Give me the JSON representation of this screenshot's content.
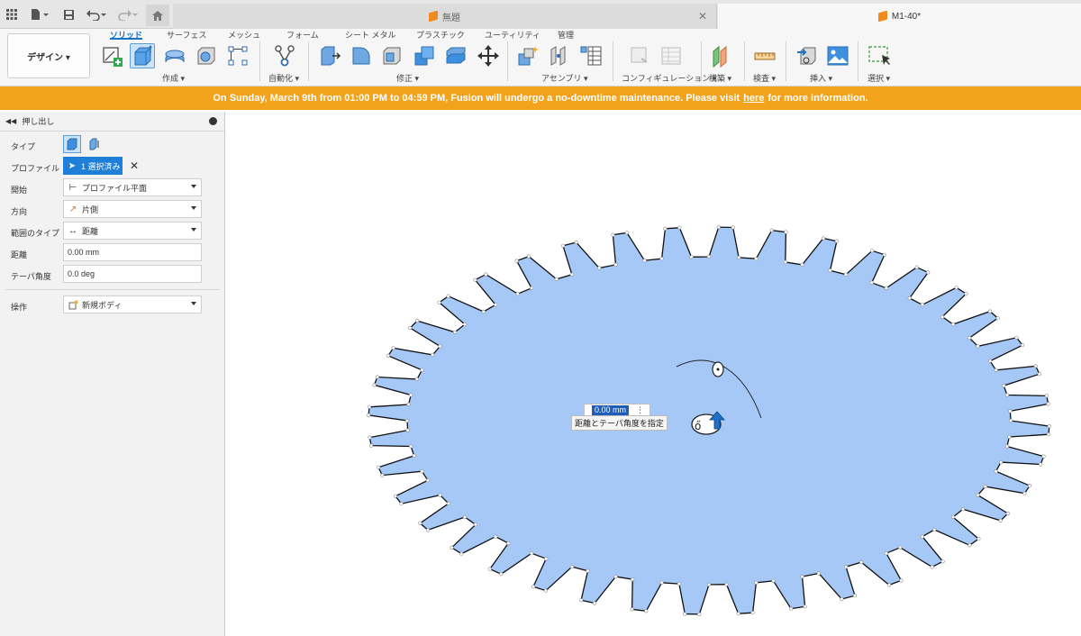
{
  "app": {
    "doc_tabs": [
      {
        "label": "無題"
      },
      {
        "label": "M1-40*"
      }
    ]
  },
  "toolbar": {
    "workspace": "デザイン ▾",
    "tabs": [
      "ソリッド",
      "サーフェス",
      "メッシュ",
      "フォーム",
      "シート メタル",
      "プラスチック",
      "ユーティリティ",
      "管理"
    ],
    "groups": {
      "create": "作成 ▾",
      "automate": "自動化 ▾",
      "modify": "修正 ▾",
      "assemble": "アセンブリ ▾",
      "configure": "コンフィギュレーション ▾",
      "construct": "構築 ▾",
      "inspect": "検査 ▾",
      "insert": "挿入 ▾",
      "select": "選択 ▾"
    }
  },
  "banner": {
    "before": "On Sunday, March 9th from 01:00 PM to 04:59 PM, Fusion will undergo a no-downtime maintenance. Please visit",
    "link": "here",
    "after": "for more information.",
    "color": "#f3a21c"
  },
  "panel": {
    "title": "押し出し",
    "rows": {
      "type_label": "タイプ",
      "profile_label": "プロファイル",
      "profile_value": "1 選択済み",
      "start_label": "開始",
      "start_value": "プロファイル平面",
      "direction_label": "方向",
      "direction_value": "片側",
      "extent_label": "範囲のタイプ",
      "extent_value": "距離",
      "distance_label": "距離",
      "distance_value": "0.00 mm",
      "taper_label": "テーパ角度",
      "taper_value": "0.0 deg",
      "operation_label": "操作",
      "operation_value": "新規ボディ"
    }
  },
  "canvas": {
    "distance_input": "0.00 mm",
    "tooltip": "距離とテーパ角度を指定",
    "gear_color": "#a6c8f7",
    "gear_teeth": 40
  }
}
